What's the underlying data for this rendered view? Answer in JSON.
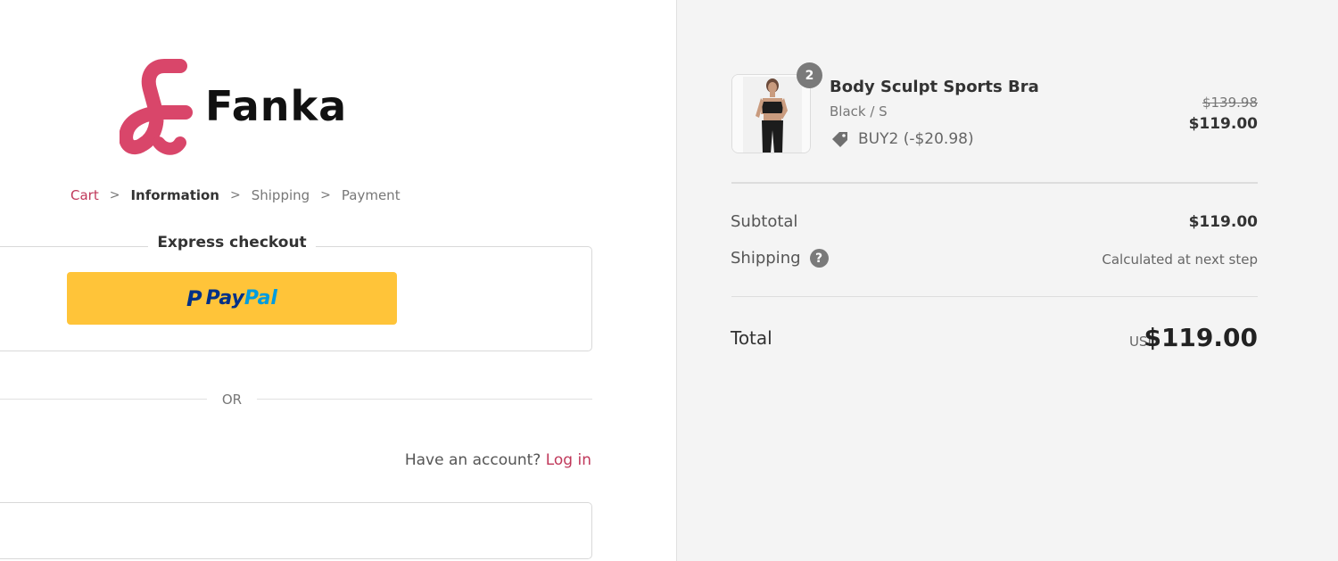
{
  "brand": {
    "name": "Fanka",
    "accent_color": "#d9466a"
  },
  "breadcrumb": {
    "cart": "Cart",
    "information": "Information",
    "shipping": "Shipping",
    "payment": "Payment"
  },
  "express": {
    "title": "Express checkout",
    "paypal_left": "Pay",
    "paypal_right": "Pal"
  },
  "divider": {
    "or": "OR"
  },
  "account": {
    "prompt": "Have an account?",
    "login": "Log in"
  },
  "email": {
    "placeholder": ""
  },
  "summary": {
    "item": {
      "quantity": "2",
      "name": "Body Sculpt Sports Bra",
      "variant": "Black / S",
      "discount": "BUY2 (-$20.98)",
      "original_price": "$139.98",
      "price": "$119.00"
    },
    "subtotal_label": "Subtotal",
    "subtotal_value": "$119.00",
    "shipping_label": "Shipping",
    "shipping_help": "?",
    "shipping_value": "Calculated at next step",
    "total_label": "Total",
    "total_currency": "USD",
    "total_value": "$119.00"
  },
  "icons": {
    "chevron": "chevron-right-icon",
    "tag": "tag-icon",
    "help": "question-circle-icon"
  }
}
